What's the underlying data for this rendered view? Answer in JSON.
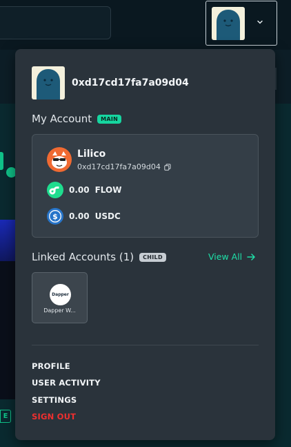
{
  "header": {
    "avatar_icon": "ghost-avatar-icon",
    "chevron_icon": "chevron-down-icon"
  },
  "dropdown": {
    "address": "0xd17cd17fa7a09d04",
    "my_account": {
      "title": "My Account",
      "badge": "MAIN",
      "name": "Lilico",
      "address": "0xd17cd17fa7a09d04",
      "copy_icon": "copy-icon",
      "balances": [
        {
          "amount": "0.00",
          "symbol": "FLOW",
          "icon": "flow-icon"
        },
        {
          "amount": "0.00",
          "symbol": "USDC",
          "icon": "usdc-icon"
        }
      ]
    },
    "linked_accounts": {
      "title": "Linked Accounts (1)",
      "badge": "CHILD",
      "view_all": "View All",
      "items": [
        {
          "logo_text": "Dapper",
          "label": "Dapper W..."
        }
      ]
    },
    "menu": {
      "profile": "PROFILE",
      "user_activity": "USER ACTIVITY",
      "settings": "SETTINGS",
      "sign_out": "SIGN OUT"
    }
  },
  "colors": {
    "accent": "#1ee0a8",
    "danger": "#ef2f2f",
    "panel": "#2a333b",
    "avatar_bg": "#f3f0dc",
    "avatar_ghost": "#1d5a78"
  }
}
